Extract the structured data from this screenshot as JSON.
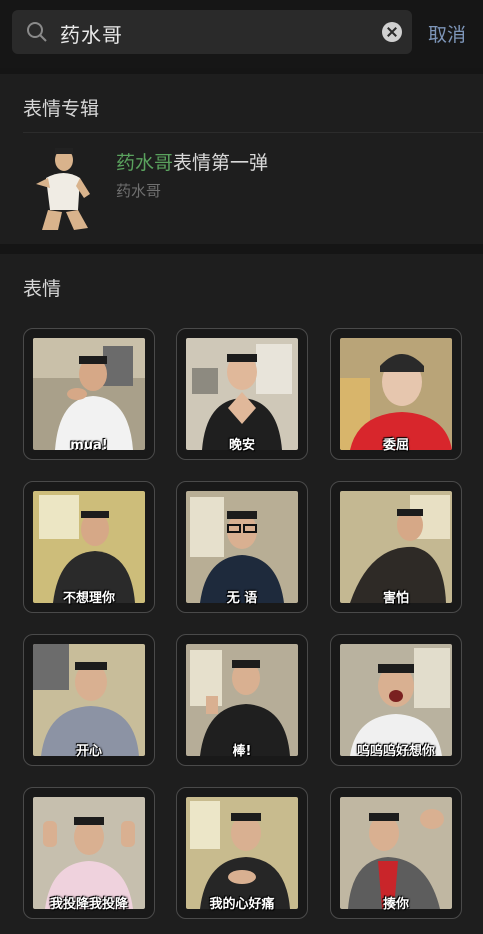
{
  "search": {
    "query": "药水哥",
    "cancel_label": "取消"
  },
  "album_section": {
    "title": "表情专辑",
    "album": {
      "title_highlight": "药水哥",
      "title_rest": "表情第一弹",
      "author": "药水哥"
    }
  },
  "emoji_section": {
    "title": "表情",
    "items": [
      {
        "caption": "mua!"
      },
      {
        "caption": "晚安"
      },
      {
        "caption": "委屈"
      },
      {
        "caption": "不想理你"
      },
      {
        "caption": "无  语"
      },
      {
        "caption": "害怕"
      },
      {
        "caption": "开心"
      },
      {
        "caption": "棒!"
      },
      {
        "caption": "呜呜呜好想你"
      },
      {
        "caption": "我投降我投降"
      },
      {
        "caption": "我的心好痛"
      },
      {
        "caption": "揍你"
      }
    ]
  }
}
